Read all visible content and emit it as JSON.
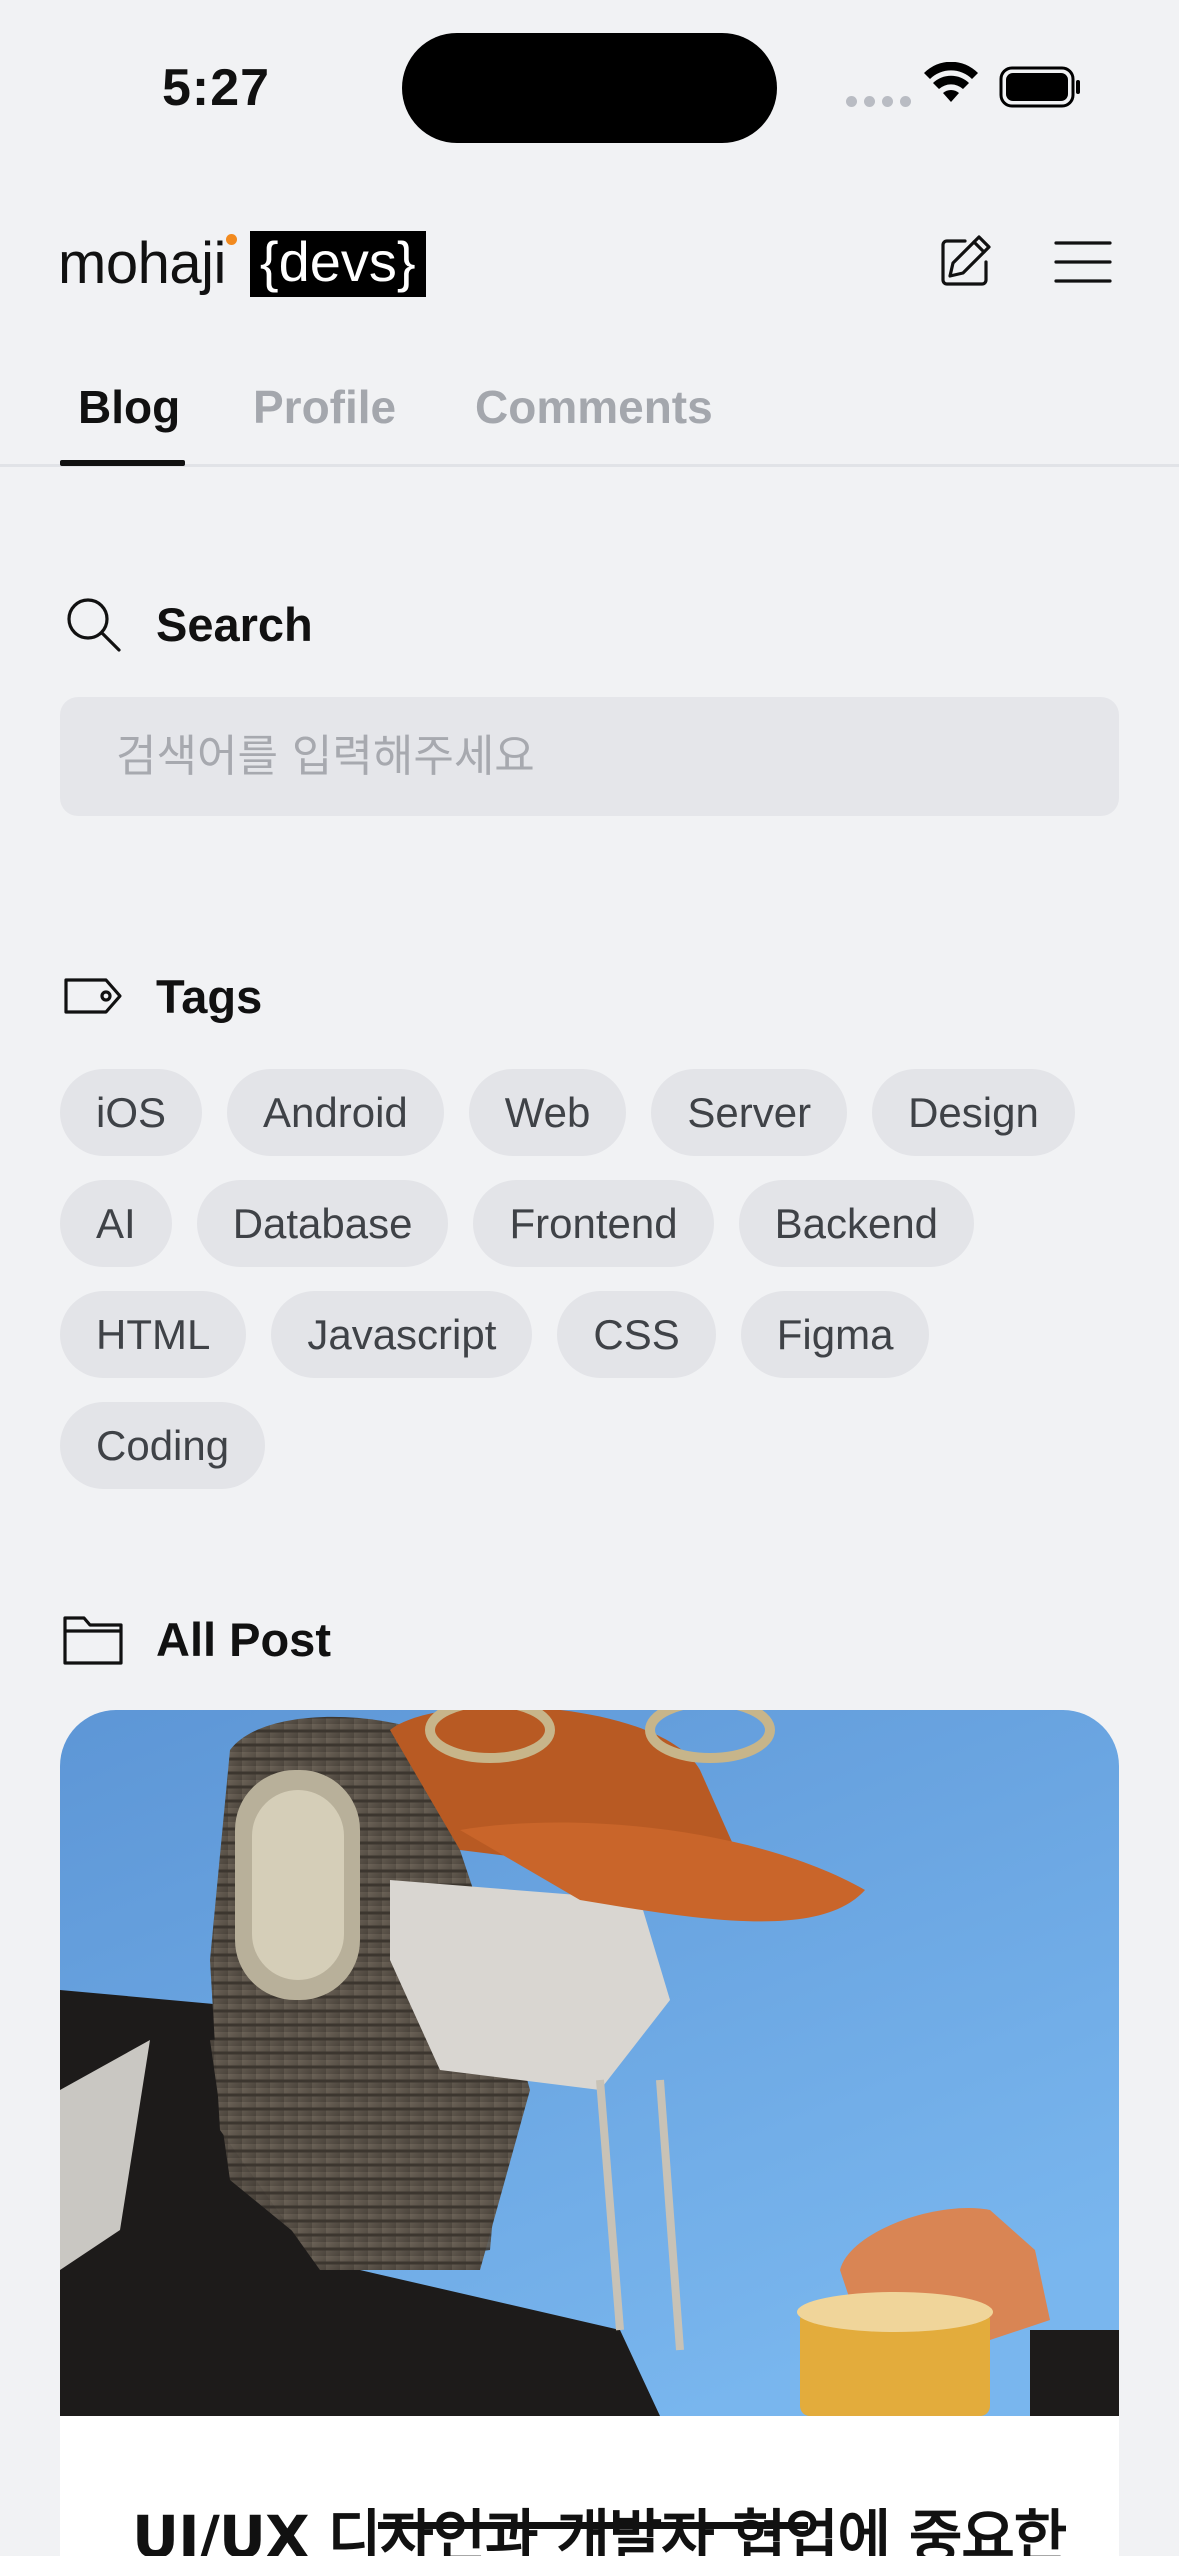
{
  "status_bar": {
    "time": "5:27"
  },
  "header": {
    "logo_word": "mohaji",
    "logo_badge": "{devs}",
    "accent_color": "#f28a1e",
    "write_icon": "pencil-square-icon",
    "menu_icon": "hamburger-menu-icon"
  },
  "tabs": [
    {
      "label": "Blog",
      "active": true
    },
    {
      "label": "Profile",
      "active": false
    },
    {
      "label": "Comments",
      "active": false
    }
  ],
  "search": {
    "title": "Search",
    "icon": "search-icon",
    "placeholder": "검색어를 입력해주세요"
  },
  "tags_section": {
    "title": "Tags",
    "icon": "tag-icon",
    "rows": [
      [
        "iOS",
        "Android",
        "Web",
        "Server",
        "Design"
      ],
      [
        "AI",
        "Database",
        "Frontend",
        "Backend"
      ],
      [
        "HTML",
        "Javascript",
        "CSS",
        "Figma"
      ],
      [
        "Coding"
      ]
    ]
  },
  "posts_section": {
    "title": "All Post",
    "icon": "folder-icon",
    "posts": [
      {
        "title": "UI/UX 디자인과 개발자 협업에 중요한"
      }
    ]
  }
}
